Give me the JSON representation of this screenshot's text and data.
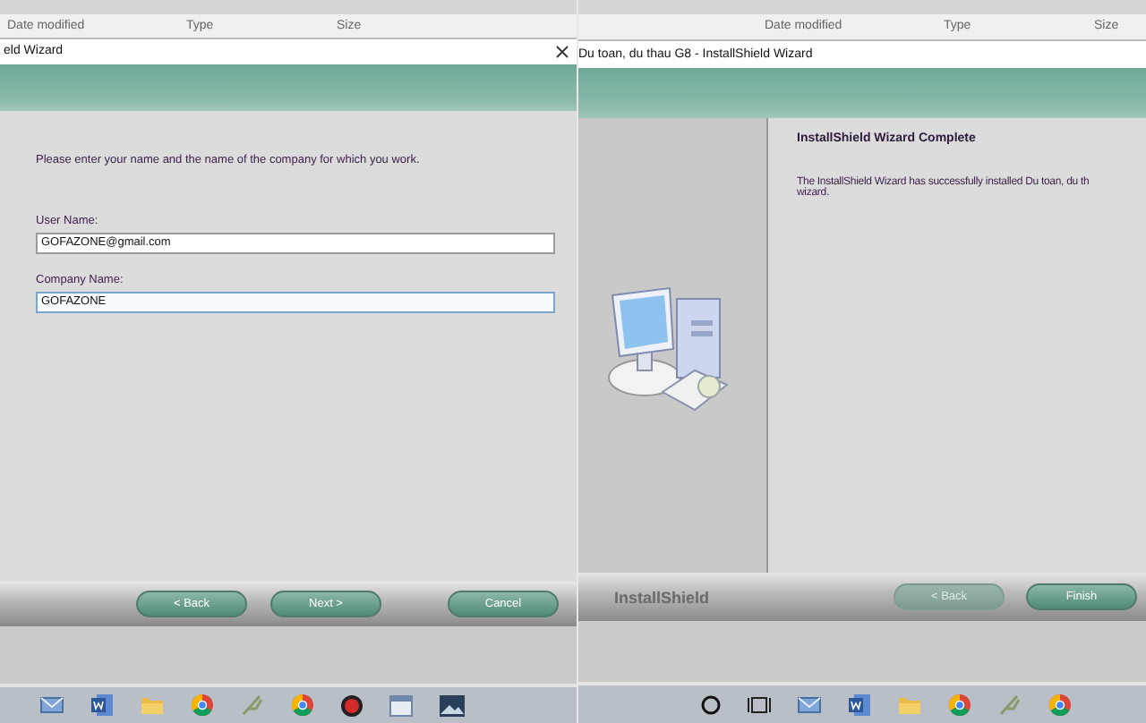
{
  "explorer": {
    "left_columns": [
      "Date modified",
      "Type",
      "Size"
    ],
    "right_columns": [
      "Date modified",
      "Type",
      "Size"
    ]
  },
  "left_wizard": {
    "title": "eld Wizard",
    "instruction": "Please enter your name and the name of the company for which you work.",
    "fields": [
      {
        "label": "User Name:",
        "value": "GOFAZONE@gmail.com",
        "focused": false
      },
      {
        "label": "Company Name:",
        "value": "GOFAZONE",
        "focused": true
      }
    ],
    "buttons": [
      {
        "label": "< Back",
        "disabled": false
      },
      {
        "label": "Next >",
        "disabled": false
      },
      {
        "label": "Cancel",
        "disabled": false
      }
    ]
  },
  "right_wizard": {
    "title": "Du toan, du thau G8 - InstallShield Wizard",
    "heading": "InstallShield Wizard Complete",
    "message_lines": [
      "The InstallShield Wizard has successfully installed Du toan, du th",
      "wizard."
    ],
    "brand": "InstallShield",
    "buttons": [
      {
        "label": "< Back",
        "disabled": true
      },
      {
        "label": "Finish",
        "disabled": false
      }
    ]
  },
  "taskbar": {
    "left_icons": [
      {
        "kind": "mail"
      },
      {
        "kind": "word"
      },
      {
        "kind": "folder"
      },
      {
        "kind": "chrome"
      },
      {
        "kind": "feather"
      },
      {
        "kind": "chrome"
      },
      {
        "kind": "record"
      },
      {
        "kind": "calendar"
      },
      {
        "kind": "photo"
      }
    ],
    "right_icons": [
      {
        "kind": "circle"
      },
      {
        "kind": "taskview"
      },
      {
        "kind": "mail"
      },
      {
        "kind": "word"
      },
      {
        "kind": "folder"
      },
      {
        "kind": "chrome"
      },
      {
        "kind": "feather"
      },
      {
        "kind": "chrome"
      }
    ]
  }
}
